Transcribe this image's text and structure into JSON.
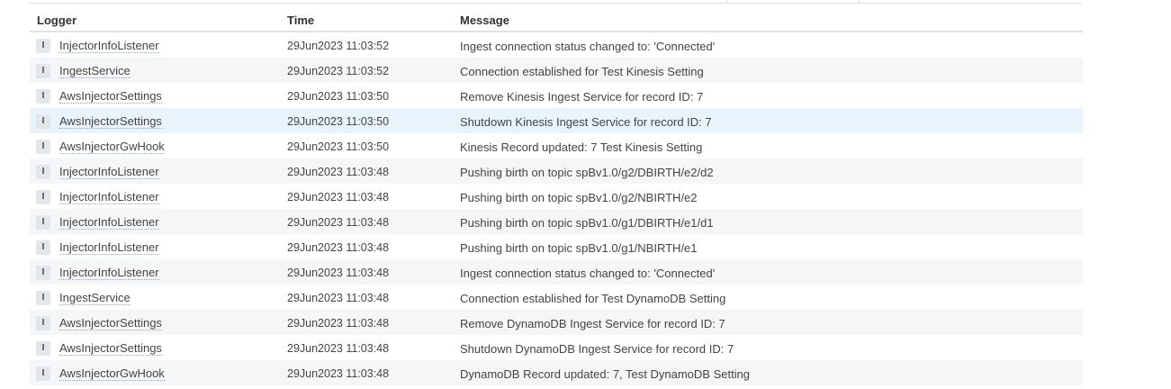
{
  "columns": {
    "logger": "Logger",
    "time": "Time",
    "message": "Message"
  },
  "rows": [
    {
      "level": "I",
      "logger": "InjectorInfoListener",
      "time": "29Jun2023 11:03:52",
      "message": "Ingest connection status changed to: 'Connected'"
    },
    {
      "level": "I",
      "logger": "IngestService",
      "time": "29Jun2023 11:03:52",
      "message": "Connection established for Test Kinesis Setting"
    },
    {
      "level": "I",
      "logger": "AwsInjectorSettings",
      "time": "29Jun2023 11:03:50",
      "message": "Remove Kinesis Ingest Service for record ID: 7"
    },
    {
      "level": "I",
      "logger": "AwsInjectorSettings",
      "time": "29Jun2023 11:03:50",
      "message": "Shutdown Kinesis Ingest Service for record ID: 7"
    },
    {
      "level": "I",
      "logger": "AwsInjectorGwHook",
      "time": "29Jun2023 11:03:50",
      "message": "Kinesis Record updated: 7 Test Kinesis Setting"
    },
    {
      "level": "I",
      "logger": "InjectorInfoListener",
      "time": "29Jun2023 11:03:48",
      "message": "Pushing birth on topic spBv1.0/g2/DBIRTH/e2/d2"
    },
    {
      "level": "I",
      "logger": "InjectorInfoListener",
      "time": "29Jun2023 11:03:48",
      "message": "Pushing birth on topic spBv1.0/g2/NBIRTH/e2"
    },
    {
      "level": "I",
      "logger": "InjectorInfoListener",
      "time": "29Jun2023 11:03:48",
      "message": "Pushing birth on topic spBv1.0/g1/DBIRTH/e1/d1"
    },
    {
      "level": "I",
      "logger": "InjectorInfoListener",
      "time": "29Jun2023 11:03:48",
      "message": "Pushing birth on topic spBv1.0/g1/NBIRTH/e1"
    },
    {
      "level": "I",
      "logger": "InjectorInfoListener",
      "time": "29Jun2023 11:03:48",
      "message": "Ingest connection status changed to: 'Connected'"
    },
    {
      "level": "I",
      "logger": "IngestService",
      "time": "29Jun2023 11:03:48",
      "message": "Connection established for Test DynamoDB Setting"
    },
    {
      "level": "I",
      "logger": "AwsInjectorSettings",
      "time": "29Jun2023 11:03:48",
      "message": "Remove DynamoDB Ingest Service for record ID: 7"
    },
    {
      "level": "I",
      "logger": "AwsInjectorSettings",
      "time": "29Jun2023 11:03:48",
      "message": "Shutdown DynamoDB Ingest Service for record ID: 7"
    },
    {
      "level": "I",
      "logger": "AwsInjectorGwHook",
      "time": "29Jun2023 11:03:48",
      "message": "DynamoDB Record updated: 7, Test DynamoDB Setting"
    }
  ],
  "colors": {
    "row_alt": "#f4f6f8",
    "row_selected": "#e8f3fc",
    "badge_bg": "#e3e6ea"
  }
}
